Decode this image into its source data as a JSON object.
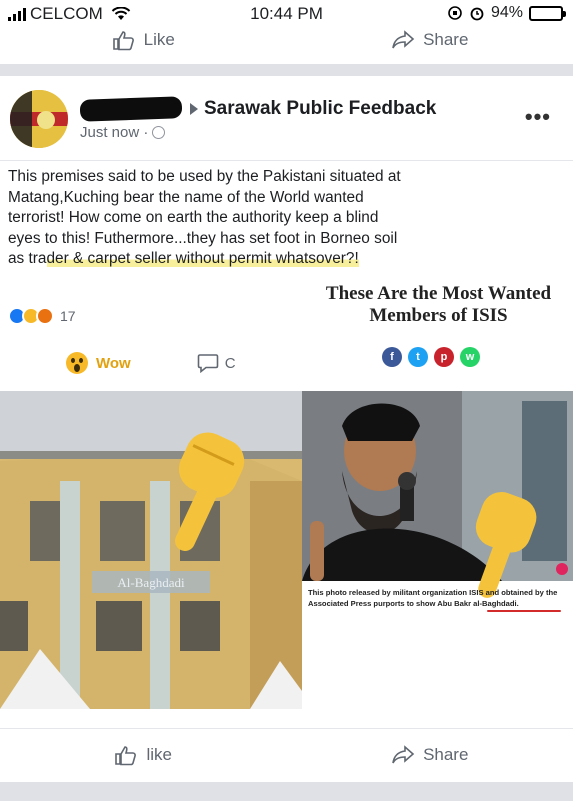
{
  "status_bar": {
    "carrier": "CELCOM",
    "time": "10:44 PM",
    "battery": "94%",
    "battery_level": 0.94
  },
  "top_actions": {
    "like": "Like",
    "share": "Share"
  },
  "post": {
    "page_name": "Sarawak Public Feedback",
    "timestamp": "Just now ·",
    "text_plain": "This premises said to be used by the Pakistani situated at Matang,Kuching bear the name of the World wanted terrorist! How come on earth the authority keep a blind eyes to this! Futhermore...they has set foot in Borneo soil as tra",
    "text_highlight": "der & carpet seller without permit whatsover?!",
    "reaction_count": "17",
    "wow_label": "Wow",
    "comment_label": "C"
  },
  "shared_image": {
    "headline": "These Are the Most Wanted Members of ISIS",
    "building_sign": "Al-Baghdadi",
    "caption": "This photo released by militant organization ISIS and obtained by the Associated Press purports to show Abu Bakr al-Baghdadi.",
    "share_icons": [
      "facebook-icon",
      "twitter-icon",
      "pinterest-icon",
      "whatsapp-icon"
    ]
  },
  "bottom_actions": {
    "like": "like",
    "share": "Share"
  },
  "colors": {
    "fb_blue": "#1877f2",
    "wow_yellow": "#f7b928",
    "highlight": "#f7ef9c",
    "divider": "#dfe1e6"
  }
}
